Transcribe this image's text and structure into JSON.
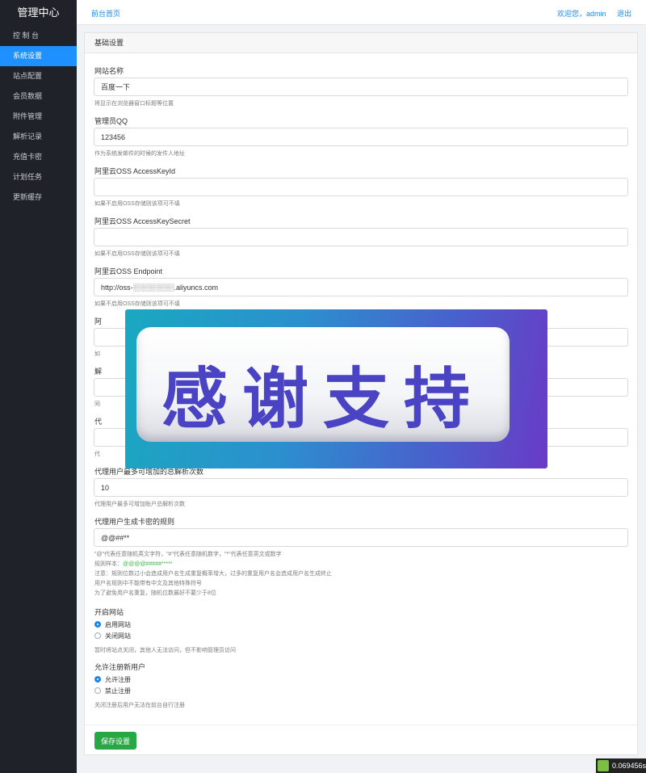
{
  "sidebar": {
    "brand": "管理中心",
    "items": [
      {
        "label": "控 制 台"
      },
      {
        "label": "系统设置"
      },
      {
        "label": "站点配置"
      },
      {
        "label": "会员数据"
      },
      {
        "label": "附件管理"
      },
      {
        "label": "解析记录"
      },
      {
        "label": "充值卡密"
      },
      {
        "label": "计划任务"
      },
      {
        "label": "更新缓存"
      }
    ],
    "active_index": 1,
    "colors": {
      "background": "#20222a",
      "active": "#1e90ff"
    }
  },
  "topbar": {
    "home_link": "前台首页",
    "welcome": "欢迎您，admin",
    "logout": "退出"
  },
  "panel": {
    "title": "基础设置",
    "fields": [
      {
        "label": "网站名称",
        "value": "百度一下",
        "help": "将显示在浏览器窗口标题等位置"
      },
      {
        "label": "管理员QQ",
        "value": "123456",
        "help": "作为系统发邮件的时候的发件人地址"
      },
      {
        "label": "阿里云OSS AccessKeyId",
        "value": "",
        "help": "如果不启用OSS存储则该项可不填"
      },
      {
        "label": "阿里云OSS AccessKeySecret",
        "value": "",
        "help": "如果不启用OSS存储则该项可不填"
      },
      {
        "label": "阿里云OSS Endpoint",
        "value": "http://oss-░░░░░░░░.aliyuncs.com",
        "help": "如果不启用OSS存储则该项可不填"
      },
      {
        "label": "阿",
        "value": "",
        "help": "如"
      },
      {
        "label": "解",
        "value": "",
        "help": "同"
      },
      {
        "label": "代",
        "value": "",
        "help": "代"
      },
      {
        "label": "代理用户最多可增加的总解析次数",
        "value": "10",
        "help": "代理用户最多可增加账户总解析次数"
      },
      {
        "label": "代理用户生成卡密的规则",
        "value": "@@##**",
        "help": ""
      }
    ],
    "rule_help": {
      "line1": "\"@\"代表任意随机英文字符，\"#\"代表任意随机数字，\"*\"代表任意英文或数字",
      "sample_prefix": "规则样本：",
      "sample_value": "@@@@#####*****",
      "line3": "注意：规则位数过小会造成用户名生成重复概率增大，过多的重复用户名会造成用户名生成终止",
      "line4": "用户名规则中不能带有中文及其他特殊符号",
      "line5": "为了避免用户名重复，随机位数最好不要少于8位"
    },
    "site_open": {
      "label": "开启网站",
      "options": [
        "启用网站",
        "关闭网站"
      ],
      "selected": 0,
      "help": "暂时将站点关闭，其他人无法访问，但不影响管理员访问"
    },
    "allow_register": {
      "label": "允许注册新用户",
      "options": [
        "允许注册",
        "禁止注册"
      ],
      "selected": 0,
      "help": "关闭注册后用户无法在前台自行注册"
    },
    "save_label": "保存设置",
    "colors": {
      "save": "#28a745",
      "accent": "#1e88e5"
    }
  },
  "overlay": {
    "text": "感谢支持"
  },
  "timer": {
    "value": "0.069456s"
  }
}
